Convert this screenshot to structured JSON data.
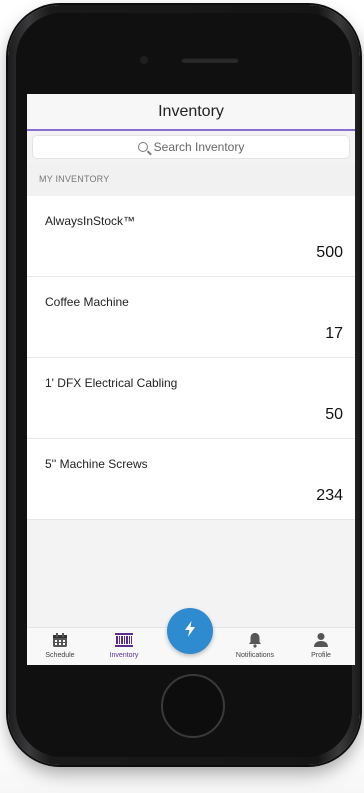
{
  "header": {
    "title": "Inventory"
  },
  "search": {
    "placeholder": "Search Inventory"
  },
  "section": {
    "label": "MY INVENTORY"
  },
  "items": [
    {
      "name": "AlwaysInStock™",
      "qty": "500"
    },
    {
      "name": "Coffee Machine",
      "qty": "17"
    },
    {
      "name": "1' DFX Electrical Cabling",
      "qty": "50"
    },
    {
      "name": "5'' Machine Screws",
      "qty": "234"
    }
  ],
  "tabs": [
    {
      "label": "Schedule",
      "icon": "calendar-icon",
      "active": false
    },
    {
      "label": "Inventory",
      "icon": "barcode-icon",
      "active": true
    },
    {
      "label": "Notifications",
      "icon": "bell-icon",
      "active": false
    },
    {
      "label": "Profile",
      "icon": "person-icon",
      "active": false
    }
  ],
  "fab": {
    "icon": "lightning-bolt-icon"
  },
  "colors": {
    "accent": "#8a6fd1",
    "fab": "#2f8bcf",
    "active_tab": "#5b2d91"
  }
}
